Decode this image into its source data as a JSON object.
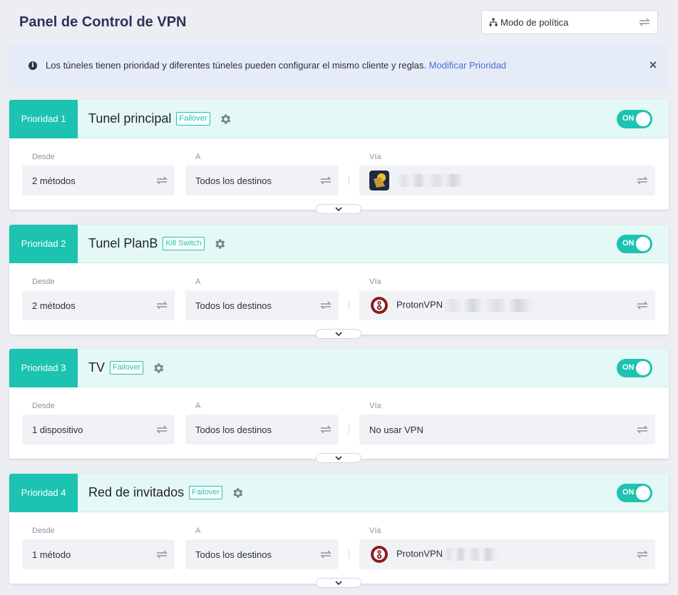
{
  "header": {
    "title": "Panel de Control de VPN",
    "mode_select": {
      "label": "Modo de política",
      "icon": "network-icon"
    }
  },
  "banner": {
    "text": "Los túneles tienen prioridad y diferentes túneles pueden configurar el mismo cliente y reglas.",
    "link": "Modificar Prioridad"
  },
  "labels": {
    "from": "Desde",
    "to": "A",
    "via": "Vía"
  },
  "colors": {
    "accent": "#1cc3b0",
    "title": "#2e3356",
    "link": "#4a6fd6",
    "header_bg": "#e4f8f6"
  },
  "tunnels": [
    {
      "priority": "Prioridad 1",
      "name": "Tunel principal",
      "mode": "Failover",
      "toggle": "ON",
      "from": "2 métodos",
      "to": "Todos los destinos",
      "via": {
        "icon": "app-logo",
        "text": ""
      }
    },
    {
      "priority": "Prioridad 2",
      "name": "Tunel PlanB",
      "mode": "Kill Switch",
      "toggle": "ON",
      "from": "2 métodos",
      "to": "Todos los destinos",
      "via": {
        "icon": "protonvpn-logo",
        "text": "ProtonVPN"
      }
    },
    {
      "priority": "Prioridad 3",
      "name": "TV",
      "mode": "Failover",
      "toggle": "ON",
      "from": "1 dispositivo",
      "to": "Todos los destinos",
      "via": {
        "icon": "",
        "text": "No usar VPN"
      }
    },
    {
      "priority": "Prioridad 4",
      "name": "Red de invitados",
      "mode": "Failover",
      "toggle": "ON",
      "from": "1 método",
      "to": "Todos los destinos",
      "via": {
        "icon": "protonvpn-logo",
        "text": "ProtonVPN"
      }
    }
  ]
}
